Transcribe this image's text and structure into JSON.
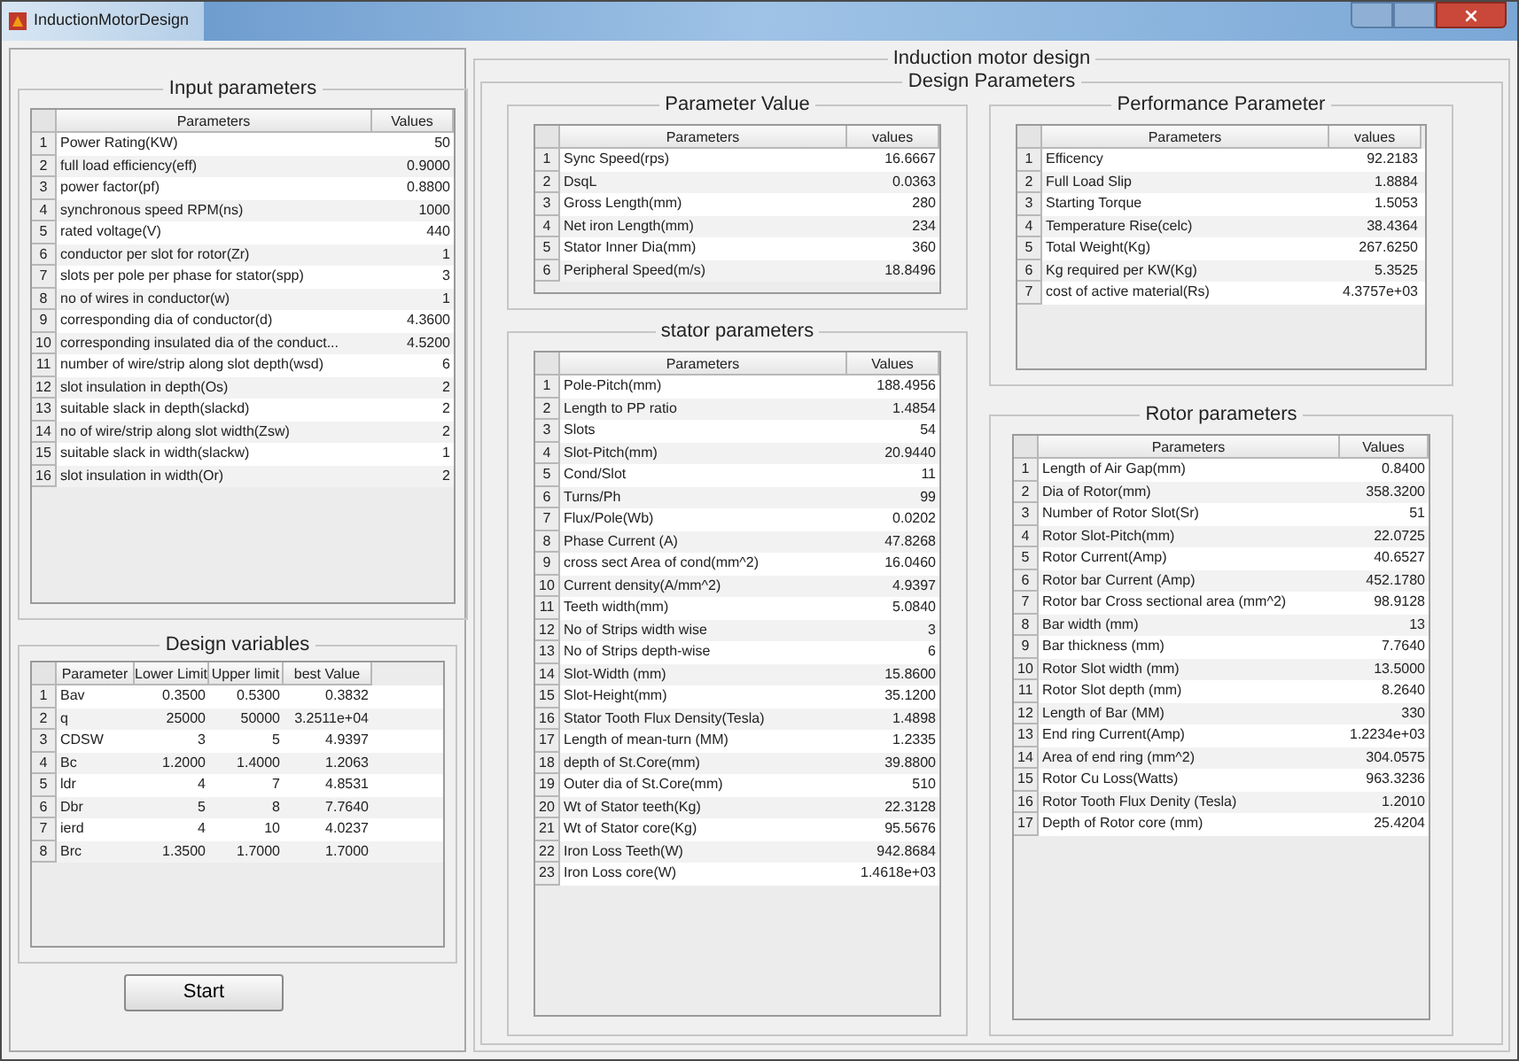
{
  "window": {
    "title": "InductionMotorDesign"
  },
  "input_parameters": {
    "title": "Input parameters",
    "columns": [
      "Parameters",
      "Values"
    ],
    "rows": [
      {
        "number": "1",
        "cells": [
          "Power Rating(KW)",
          "50"
        ]
      },
      {
        "number": "2",
        "cells": [
          "full load efficiency(eff)",
          "0.9000"
        ]
      },
      {
        "number": "3",
        "cells": [
          "power factor(pf)",
          "0.8800"
        ]
      },
      {
        "number": "4",
        "cells": [
          "synchronous speed RPM(ns)",
          "1000"
        ]
      },
      {
        "number": "5",
        "cells": [
          "rated voltage(V)",
          "440"
        ]
      },
      {
        "number": "6",
        "cells": [
          "conductor per slot for rotor(Zr)",
          "1"
        ]
      },
      {
        "number": "7",
        "cells": [
          "slots per pole per phase for stator(spp)",
          "3"
        ]
      },
      {
        "number": "8",
        "cells": [
          "no of wires in conductor(w)",
          "1"
        ]
      },
      {
        "number": "9",
        "cells": [
          "corresponding dia of conductor(d)",
          "4.3600"
        ]
      },
      {
        "number": "10",
        "cells": [
          "corresponding insulated dia of the conduct...",
          "4.5200"
        ]
      },
      {
        "number": "11",
        "cells": [
          "number of wire/strip along slot depth(wsd)",
          "6"
        ]
      },
      {
        "number": "12",
        "cells": [
          "slot insulation in depth(Os)",
          "2"
        ]
      },
      {
        "number": "13",
        "cells": [
          "suitable slack in depth(slackd)",
          "2"
        ]
      },
      {
        "number": "14",
        "cells": [
          "no of wire/strip along slot width(Zsw)",
          "2"
        ]
      },
      {
        "number": "15",
        "cells": [
          "suitable slack in width(slackw)",
          "1"
        ]
      },
      {
        "number": "16",
        "cells": [
          "slot insulation in width(Or)",
          "2"
        ]
      }
    ]
  },
  "design_variables": {
    "title": "Design variables",
    "columns": [
      "Parameter",
      "Lower Limit",
      "Upper limit",
      "best Value"
    ],
    "rows": [
      {
        "number": "1",
        "cells": [
          "Bav",
          "0.3500",
          "0.5300",
          "0.3832"
        ]
      },
      {
        "number": "2",
        "cells": [
          "q",
          "25000",
          "50000",
          "3.2511e+04"
        ]
      },
      {
        "number": "3",
        "cells": [
          "CDSW",
          "3",
          "5",
          "4.9397"
        ]
      },
      {
        "number": "4",
        "cells": [
          "Bc",
          "1.2000",
          "1.4000",
          "1.2063"
        ]
      },
      {
        "number": "5",
        "cells": [
          "ldr",
          "4",
          "7",
          "4.8531"
        ]
      },
      {
        "number": "6",
        "cells": [
          "Dbr",
          "5",
          "8",
          "7.7640"
        ]
      },
      {
        "number": "7",
        "cells": [
          "ierd",
          "4",
          "10",
          "4.0237"
        ]
      },
      {
        "number": "8",
        "cells": [
          "Brc",
          "1.3500",
          "1.7000",
          "1.7000"
        ]
      }
    ]
  },
  "start_button": "Start",
  "main_group": {
    "title": "Induction motor design"
  },
  "design_parameters": {
    "title": "Design Parameters",
    "parameter_value": {
      "title": "Parameter Value",
      "columns": [
        "Parameters",
        "values"
      ],
      "rows": [
        {
          "number": "1",
          "cells": [
            "Sync Speed(rps)",
            "16.6667"
          ]
        },
        {
          "number": "2",
          "cells": [
            "DsqL",
            "0.0363"
          ]
        },
        {
          "number": "3",
          "cells": [
            "Gross Length(mm)",
            "280"
          ]
        },
        {
          "number": "4",
          "cells": [
            "Net iron Length(mm)",
            "234"
          ]
        },
        {
          "number": "5",
          "cells": [
            "Stator Inner Dia(mm)",
            "360"
          ]
        },
        {
          "number": "6",
          "cells": [
            "Peripheral Speed(m/s)",
            "18.8496"
          ]
        }
      ]
    },
    "stator_parameters": {
      "title": "stator parameters",
      "columns": [
        "Parameters",
        "Values"
      ],
      "rows": [
        {
          "number": "1",
          "cells": [
            "Pole-Pitch(mm)",
            "188.4956"
          ]
        },
        {
          "number": "2",
          "cells": [
            "Length to PP ratio",
            "1.4854"
          ]
        },
        {
          "number": "3",
          "cells": [
            "Slots",
            "54"
          ]
        },
        {
          "number": "4",
          "cells": [
            "Slot-Pitch(mm)",
            "20.9440"
          ]
        },
        {
          "number": "5",
          "cells": [
            "Cond/Slot",
            "11"
          ]
        },
        {
          "number": "6",
          "cells": [
            "Turns/Ph",
            "99"
          ]
        },
        {
          "number": "7",
          "cells": [
            "Flux/Pole(Wb)",
            "0.0202"
          ]
        },
        {
          "number": "8",
          "cells": [
            "Phase Current (A)",
            "47.8268"
          ]
        },
        {
          "number": "9",
          "cells": [
            "cross sect Area of cond(mm^2)",
            "16.0460"
          ]
        },
        {
          "number": "10",
          "cells": [
            "Current density(A/mm^2)",
            "4.9397"
          ]
        },
        {
          "number": "11",
          "cells": [
            "Teeth width(mm)",
            "5.0840"
          ]
        },
        {
          "number": "12",
          "cells": [
            "No of Strips width wise",
            "3"
          ]
        },
        {
          "number": "13",
          "cells": [
            "No of Strips depth-wise",
            "6"
          ]
        },
        {
          "number": "14",
          "cells": [
            "Slot-Width (mm)",
            "15.8600"
          ]
        },
        {
          "number": "15",
          "cells": [
            "Slot-Height(mm)",
            "35.1200"
          ]
        },
        {
          "number": "16",
          "cells": [
            "Stator Tooth Flux Density(Tesla)",
            "1.4898"
          ]
        },
        {
          "number": "17",
          "cells": [
            "Length of mean-turn (MM)",
            "1.2335"
          ]
        },
        {
          "number": "18",
          "cells": [
            "depth of St.Core(mm)",
            "39.8800"
          ]
        },
        {
          "number": "19",
          "cells": [
            "Outer dia of St.Core(mm)",
            "510"
          ]
        },
        {
          "number": "20",
          "cells": [
            "Wt of  Stator teeth(Kg)",
            "22.3128"
          ]
        },
        {
          "number": "21",
          "cells": [
            "Wt of  Stator core(Kg)",
            "95.5676"
          ]
        },
        {
          "number": "22",
          "cells": [
            "Iron Loss  Teeth(W)",
            "942.8684"
          ]
        },
        {
          "number": "23",
          "cells": [
            "Iron Loss  core(W)",
            "1.4618e+03"
          ]
        }
      ]
    },
    "performance_parameter": {
      "title": "Performance Parameter",
      "columns": [
        "Parameters",
        "values"
      ],
      "rows": [
        {
          "number": "1",
          "cells": [
            "Efficency",
            "92.2183"
          ]
        },
        {
          "number": "2",
          "cells": [
            "Full Load Slip",
            "1.8884"
          ]
        },
        {
          "number": "3",
          "cells": [
            "Starting Torque",
            "1.5053"
          ]
        },
        {
          "number": "4",
          "cells": [
            "Temperature Rise(celc)",
            "38.4364"
          ]
        },
        {
          "number": "5",
          "cells": [
            "Total Weight(Kg)",
            "267.6250"
          ]
        },
        {
          "number": "6",
          "cells": [
            "Kg required per KW(Kg)",
            "5.3525"
          ]
        },
        {
          "number": "7",
          "cells": [
            "cost of active material(Rs)",
            "4.3757e+03"
          ]
        }
      ]
    },
    "rotor_parameters": {
      "title": "Rotor parameters",
      "columns": [
        "Parameters",
        "Values"
      ],
      "rows": [
        {
          "number": "1",
          "cells": [
            "Length of Air Gap(mm)",
            "0.8400"
          ]
        },
        {
          "number": "2",
          "cells": [
            "Dia of Rotor(mm)",
            "358.3200"
          ]
        },
        {
          "number": "3",
          "cells": [
            "Number of Rotor Slot(Sr)",
            "51"
          ]
        },
        {
          "number": "4",
          "cells": [
            "Rotor Slot-Pitch(mm)",
            "22.0725"
          ]
        },
        {
          "number": "5",
          "cells": [
            "Rotor Current(Amp)",
            "40.6527"
          ]
        },
        {
          "number": "6",
          "cells": [
            "Rotor bar Current (Amp)",
            "452.1780"
          ]
        },
        {
          "number": "7",
          "cells": [
            "Rotor bar Cross sectional area (mm^2)",
            "98.9128"
          ]
        },
        {
          "number": "8",
          "cells": [
            "Bar width (mm)",
            "13"
          ]
        },
        {
          "number": "9",
          "cells": [
            "Bar thickness (mm)",
            "7.7640"
          ]
        },
        {
          "number": "10",
          "cells": [
            "Rotor Slot width (mm)",
            "13.5000"
          ]
        },
        {
          "number": "11",
          "cells": [
            "Rotor Slot depth (mm)",
            "8.2640"
          ]
        },
        {
          "number": "12",
          "cells": [
            "Length of Bar (MM)",
            "330"
          ]
        },
        {
          "number": "13",
          "cells": [
            "End ring Current(Amp)",
            "1.2234e+03"
          ]
        },
        {
          "number": "14",
          "cells": [
            "Area of end ring (mm^2)",
            "304.0575"
          ]
        },
        {
          "number": "15",
          "cells": [
            "Rotor Cu Loss(Watts)",
            "963.3236"
          ]
        },
        {
          "number": "16",
          "cells": [
            "Rotor Tooth Flux Denity (Tesla)",
            "1.2010"
          ]
        },
        {
          "number": "17",
          "cells": [
            "Depth of Rotor core (mm)",
            "25.4204"
          ]
        }
      ]
    }
  }
}
